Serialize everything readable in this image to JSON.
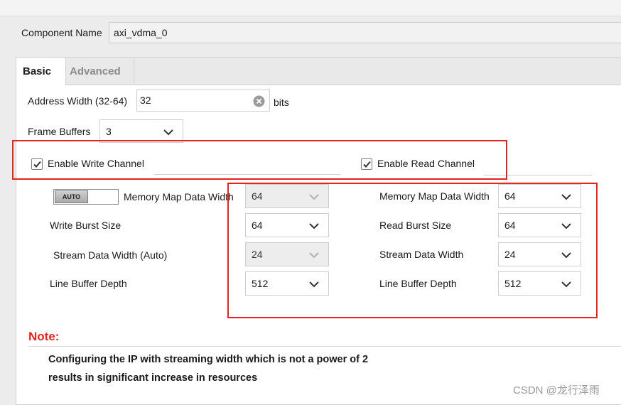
{
  "component": {
    "label": "Component Name",
    "value": "axi_vdma_0"
  },
  "tabs": [
    {
      "label": "Basic",
      "active": true
    },
    {
      "label": "Advanced",
      "active": false
    }
  ],
  "basic": {
    "address_width": {
      "label": "Address Width (32-64)",
      "value": "32",
      "unit": "bits"
    },
    "frame_buffers": {
      "label": "Frame Buffers",
      "value": "3"
    },
    "write_channel": {
      "label": "Enable Write Channel",
      "checked": true,
      "auto_toggle": "AUTO",
      "mm_data_width": {
        "label": "Memory Map Data Width",
        "value": "64",
        "disabled": true
      },
      "burst_size": {
        "label": "Write Burst Size",
        "value": "64"
      },
      "stream_width": {
        "label": "Stream Data Width (Auto)",
        "value": "24",
        "disabled": true
      },
      "line_buffer": {
        "label": "Line Buffer Depth",
        "value": "512"
      }
    },
    "read_channel": {
      "label": "Enable Read Channel",
      "checked": true,
      "mm_data_width": {
        "label": "Memory Map Data Width",
        "value": "64"
      },
      "burst_size": {
        "label": "Read Burst Size",
        "value": "64"
      },
      "stream_width": {
        "label": "Stream Data Width",
        "value": "24"
      },
      "line_buffer": {
        "label": "Line Buffer Depth",
        "value": "512"
      }
    }
  },
  "note": {
    "title": "Note:",
    "line1": "Configuring the IP with streaming width which is not a power of 2",
    "line2": "results in significant increase in resources"
  },
  "watermark": "CSDN @龙行泽雨",
  "colors": {
    "highlight": "#e5231f",
    "note": "#e5231f",
    "panel": "#ffffff"
  },
  "icons": {
    "clear": "clear-circle-icon",
    "dropdown": "chevron-down-icon",
    "check": "checkmark-icon"
  }
}
